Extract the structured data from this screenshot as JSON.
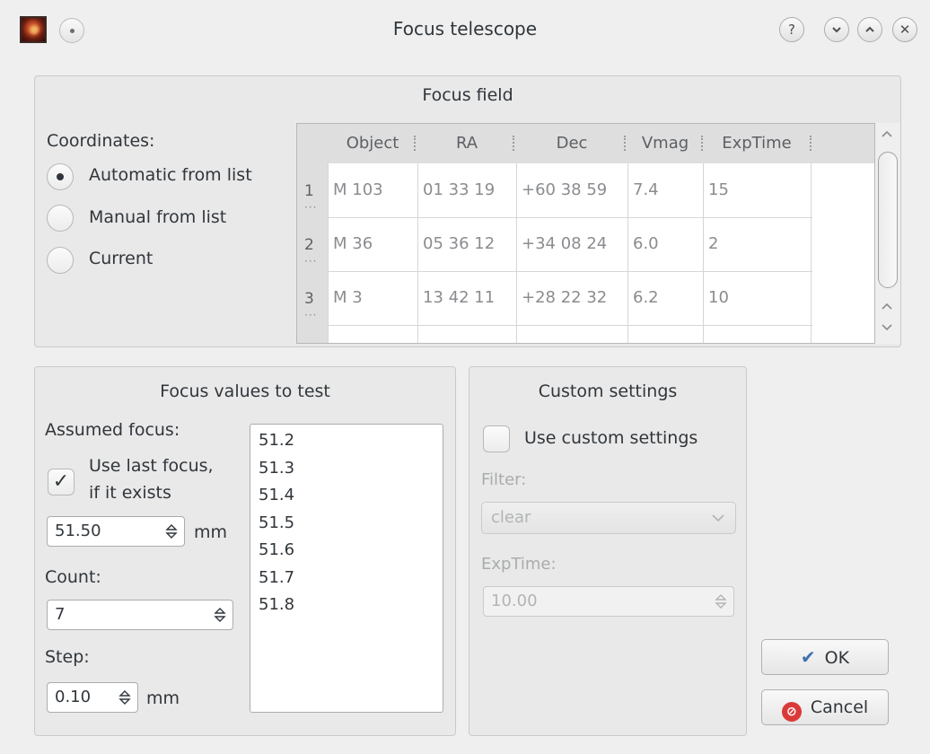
{
  "window": {
    "title": "Focus telescope",
    "controls": {
      "help": "?",
      "minimize": "⌄",
      "maximize": "⌃",
      "close": "✕"
    }
  },
  "focus_field": {
    "title": "Focus field",
    "coordinates_label": "Coordinates:",
    "options": [
      "Automatic from list",
      "Manual from list",
      "Current"
    ],
    "selected": "Automatic from list",
    "table": {
      "columns": [
        "Object",
        "RA",
        "Dec",
        "Vmag",
        "ExpTime"
      ],
      "rows": [
        {
          "num": "1",
          "object": "M 103",
          "ra": "01 33 19",
          "dec": "+60 38 59",
          "vmag": "7.4",
          "exptime": "15"
        },
        {
          "num": "2",
          "object": "M 36",
          "ra": "05 36 12",
          "dec": "+34 08 24",
          "vmag": "6.0",
          "exptime": "2"
        },
        {
          "num": "3",
          "object": "M 3",
          "ra": "13 42 11",
          "dec": "+28 22 32",
          "vmag": "6.2",
          "exptime": "10"
        }
      ]
    }
  },
  "focus_values": {
    "title": "Focus values to test",
    "assumed_label": "Assumed focus:",
    "use_last_line1": "Use last focus,",
    "use_last_line2": "if it exists",
    "use_last_checked": true,
    "assumed_value": "51.50",
    "unit": "mm",
    "count_label": "Count:",
    "count_value": "7",
    "step_label": "Step:",
    "step_value": "0.10",
    "step_unit": "mm",
    "values": [
      "51.2",
      "51.3",
      "51.4",
      "51.5",
      "51.6",
      "51.7",
      "51.8"
    ]
  },
  "custom_settings": {
    "title": "Custom settings",
    "checkbox_label": "Use custom settings",
    "checked": false,
    "filter_label": "Filter:",
    "filter_value": "clear",
    "exptime_label": "ExpTime:",
    "exptime_value": "10.00"
  },
  "buttons": {
    "ok": "OK",
    "cancel": "Cancel"
  },
  "icons": {
    "app": "telescope-app-icon",
    "ok": "checkmark-icon",
    "cancel": "cancel-icon",
    "spin": "updown-arrows-icon",
    "combo": "chevron-down-icon"
  },
  "colors": {
    "background": "#efefef",
    "text": "#31363b",
    "disabled_text": "#a9abad",
    "ok_accent": "#3d6fb0",
    "cancel_accent": "#da3a3a"
  }
}
